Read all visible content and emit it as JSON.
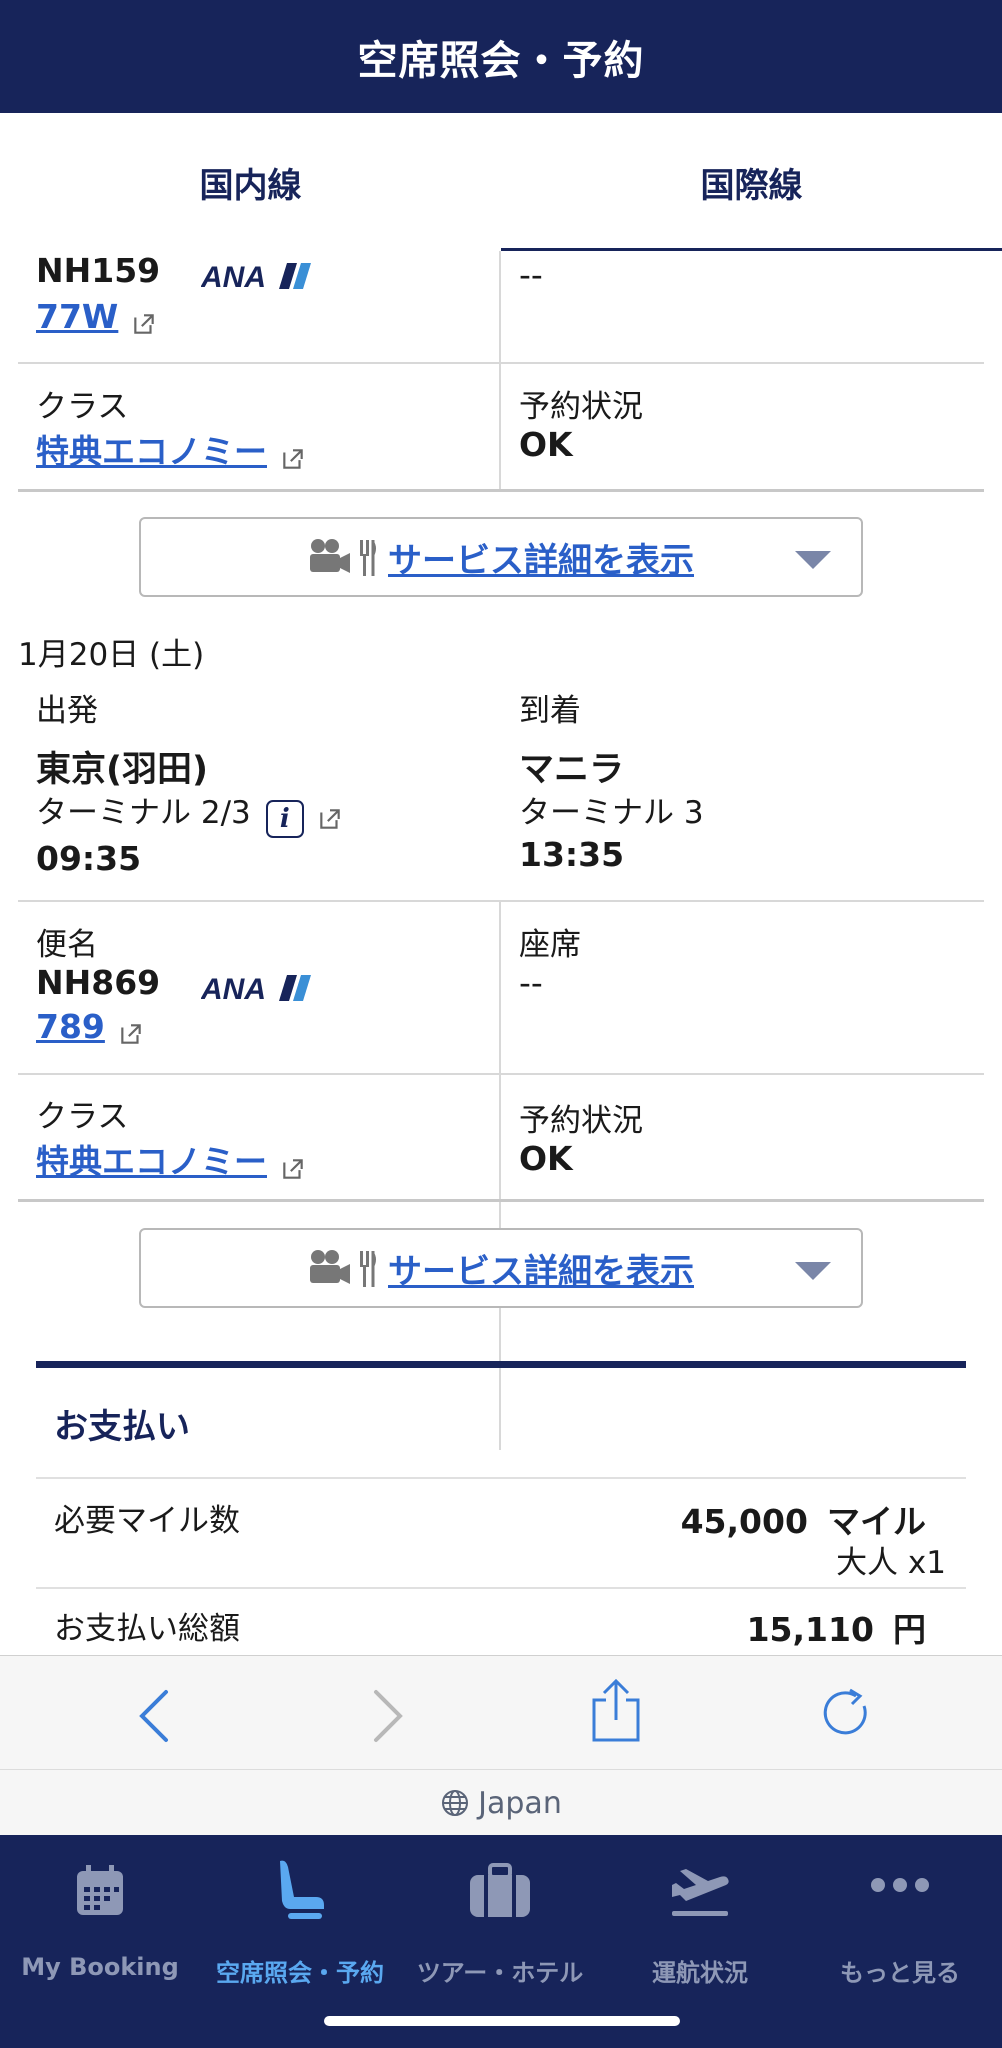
{
  "header": {
    "title": "空席照会・予約"
  },
  "tabs": [
    {
      "label": "国内線",
      "active": false
    },
    {
      "label": "国際線",
      "active": true
    }
  ],
  "segment1": {
    "flight_no": "NH159",
    "aircraft": "77W",
    "seat_value": "--",
    "class_label": "クラス",
    "class_value": "特典エコノミー",
    "status_label": "予約状況",
    "status_value": "OK"
  },
  "service_button": {
    "label": "サービス詳細を表示"
  },
  "segment2": {
    "date": "1月20日 (土)",
    "depart_label": "出発",
    "arrive_label": "到着",
    "depart_city": "東京(羽田)",
    "depart_terminal": "ターミナル 2/3",
    "depart_time": "09:35",
    "arrive_city": "マニラ",
    "arrive_terminal": "ターミナル 3",
    "arrive_time": "13:35",
    "flight_label": "便名",
    "flight_no": "NH869",
    "aircraft": "789",
    "seat_label": "座席",
    "seat_value": "--",
    "class_label": "クラス",
    "class_value": "特典エコノミー",
    "status_label": "予約状況",
    "status_value": "OK"
  },
  "payment": {
    "title": "お支払い",
    "miles_label": "必要マイル数",
    "miles_value": "45,000",
    "miles_unit": "マイル",
    "pax": "大人 x1",
    "total_label": "お支払い総額",
    "total_value": "15,110",
    "total_unit": "円"
  },
  "browser": {
    "locale": "Japan"
  },
  "tabbar": [
    {
      "label": "My Booking",
      "icon": "calendar-icon",
      "active": false
    },
    {
      "label": "空席照会・予約",
      "icon": "seat-icon",
      "active": true
    },
    {
      "label": "ツアー・ホテル",
      "icon": "suitcase-icon",
      "active": false
    },
    {
      "label": "運航状況",
      "icon": "plane-departure-icon",
      "active": false
    },
    {
      "label": "もっと見る",
      "icon": "more-icon",
      "active": false
    }
  ],
  "colors": {
    "brand_navy": "#17245a",
    "link_blue": "#2a5fc8",
    "active_tab": "#5aa8f0"
  }
}
